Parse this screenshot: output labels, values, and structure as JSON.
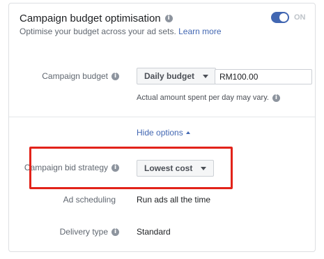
{
  "header": {
    "title": "Campaign budget optimisation",
    "subtitle": "Optimise your budget across your ad sets.",
    "learn_more": "Learn more",
    "toggle_state": "ON"
  },
  "budget": {
    "label": "Campaign budget",
    "type_selected": "Daily budget",
    "amount": "RM100.00",
    "note": "Actual amount spent per day may vary."
  },
  "options": {
    "hide_label": "Hide options"
  },
  "bid_strategy": {
    "label": "Campaign bid strategy",
    "selected": "Lowest cost"
  },
  "ad_scheduling": {
    "label": "Ad scheduling",
    "value": "Run ads all the time"
  },
  "delivery_type": {
    "label": "Delivery type",
    "value": "Standard"
  },
  "colors": {
    "accent": "#4267b2",
    "highlight": "#e2231a"
  },
  "icons": {
    "info": "info-icon",
    "caret": "chevron-down-icon",
    "caret_up": "chevron-up-icon"
  }
}
